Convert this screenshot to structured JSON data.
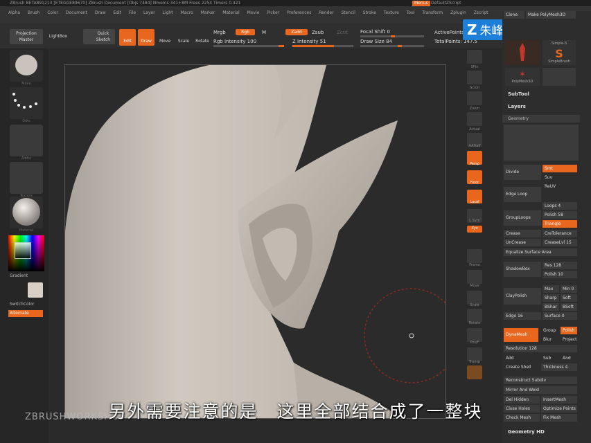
{
  "titlebar": {
    "text": "ZBrush BETA891213 [ETEGGE89670]   ZBrush Document   [Objs 7484] Nmems 341+8M Frees 2254 Timers 0.421",
    "menu_label": "Menus",
    "script_label": "DefaultZScript"
  },
  "menubar": {
    "items": [
      "Alpha",
      "Brush",
      "Color",
      "Document",
      "Draw",
      "Edit",
      "File",
      "Layer",
      "Light",
      "Macro",
      "Marker",
      "Material",
      "Movie",
      "Picker",
      "Preferences",
      "Render",
      "Stencil",
      "Stroke",
      "Texture",
      "Tool",
      "Transform",
      "Zplugin",
      "Zscript"
    ]
  },
  "toolbar": {
    "projection_master": "Projection Master",
    "lightbox": "LightBox",
    "quick_sketch": "Quick Sketch",
    "edit": "Edit",
    "draw": "Draw",
    "move": "Move",
    "scale": "Scale",
    "rotate": "Rotate",
    "mrgb": "Mrgb",
    "rgb": "Rgb",
    "m": "M",
    "rgb_intensity": "Rgb Intensity 100",
    "zadd": "Zadd",
    "zsub": "Zsub",
    "zcut": "Zcut",
    "z_intensity": "Z Intensity 51",
    "focal_shift": "Focal Shift 0",
    "draw_size": "Draw Size 84",
    "active_points": "ActivePoints:",
    "total_points": "TotalPoints: 147.5"
  },
  "logo": {
    "letter": "Z",
    "text": "朱峰社区"
  },
  "left_shelf": {
    "brush_label": "Move",
    "stroke_label": "Dots",
    "alpha_label": "Alpha",
    "texture_label": "Texture",
    "material_label": "Material",
    "gradient_label": "Gradient",
    "switch_color_label": "SwitchColor",
    "alternate_label": "Alternate"
  },
  "right_shelf": {
    "items": [
      "SPix",
      "Scroll",
      "Zoom",
      "Actual",
      "AAHalf",
      "Persp",
      "Floor",
      "Local",
      "L.Sym",
      "Xyz",
      "Frame",
      "Move",
      "Scale",
      "Rotate",
      "PolyF",
      "Transp"
    ]
  },
  "tray": {
    "top_buttons": [
      "Clone",
      "Make PolyMesh3D"
    ],
    "tool_labels": [
      "Simple-S",
      "SimpleBrush",
      "PolyMesh3D"
    ],
    "subtool": "SubTool",
    "layers": "Layers",
    "geometry": "Geometry",
    "geometry_hd": "Geometry HD",
    "buttons": {
      "divide": "Divide",
      "smt": "Smt",
      "suv": "Suv",
      "reuv": "ReUV",
      "edge_loop": "Edge Loop",
      "group_loops": "GroupLoops",
      "loops": "Loops 4",
      "polish": "Polish 58",
      "triangle": "Triangle",
      "crease": "Crease",
      "uncrease": "UnCrease",
      "creaselvl": "CreaseLvl 15",
      "cretolerance": "CreTolerance",
      "equalize": "Equalize Surface Area",
      "shadowbox": "ShadowBox",
      "res": "Res 128",
      "polish2": "Polish 10",
      "claypolish": "ClayPolish",
      "max": "Max",
      "min": "Min 0",
      "sharp": "Sharp",
      "soft": "Soft",
      "bshar": "BShar",
      "bsoft": "BSoft",
      "edge": "Edge 16",
      "surface": "Surface 0",
      "dynamesh": "DynaMesh",
      "group": "Group",
      "polish3": "Polish",
      "blur": "Blur",
      "project": "Project",
      "resolution": "Resolution 128",
      "add": "Add",
      "sub": "Sub",
      "and": "And",
      "create_shell": "Create Shell",
      "thickness": "Thickness 4",
      "reconstruct": "Reconstruct Subdiv",
      "mirror_weld": "Mirror And Weld",
      "del_hidden": "Del Hidden",
      "insert_mesh": "InsertMesh",
      "close_holes": "Close Holes",
      "optimize_points": "Optimize Points",
      "check_mesh": "Check Mesh",
      "fix_mesh": "Fix Mesh"
    }
  },
  "subtitle": "另外需要注意的是　这里全部结合成了一整块",
  "watermark": "ZBRUSHWORKSHOP",
  "colors": {
    "accent": "#e8661e",
    "background": "#2b2b2b",
    "model": "#c6beb5",
    "logo": "#1e7fd8"
  }
}
